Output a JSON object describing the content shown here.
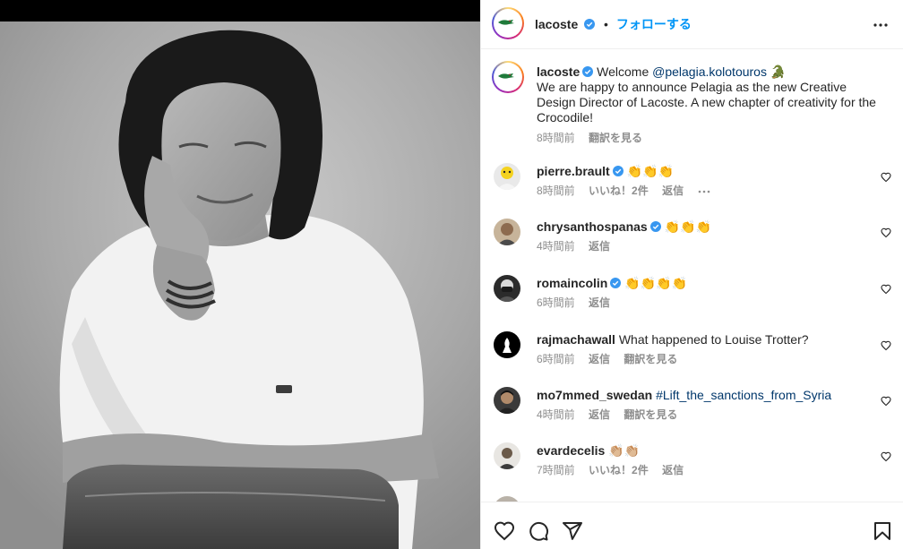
{
  "photo": {
    "alt": "Black and white portrait photo"
  },
  "header": {
    "username": "lacoste",
    "separator": "•",
    "follow_label": "フォローする"
  },
  "caption": {
    "username": "lacoste",
    "welcome": "Welcome ",
    "mention": "@pelagia.kolotouros",
    "emoji": "🐊",
    "text": "We are happy to announce Pelagia as the new Creative Design Director of Lacoste. A new chapter of creativity for the Crocodile!",
    "time": "8時間前",
    "see_translation": "翻訳を見る"
  },
  "comments": [
    {
      "username": "pierre.brault",
      "verified": true,
      "text": "👏👏👏",
      "time": "8時間前",
      "likes": "いいね！2件",
      "reply": "返信",
      "translate": ""
    },
    {
      "username": "chrysanthospanas",
      "verified": true,
      "text": "👏👏👏",
      "time": "4時間前",
      "likes": "",
      "reply": "返信",
      "translate": ""
    },
    {
      "username": "romaincolin",
      "verified": true,
      "text": "👏👏👏👏",
      "time": "6時間前",
      "likes": "",
      "reply": "返信",
      "translate": ""
    },
    {
      "username": "rajmachawall",
      "verified": false,
      "text": "What happened to Louise Trotter?",
      "time": "6時間前",
      "likes": "",
      "reply": "返信",
      "translate": "翻訳を見る"
    },
    {
      "username": "mo7mmed_swedan",
      "verified": false,
      "text": "#Lift_the_sanctions_from_Syria",
      "time": "4時間前",
      "likes": "",
      "reply": "返信",
      "translate": "翻訳を見る"
    },
    {
      "username": "evardecelis",
      "verified": false,
      "text": "👏🏼👏🏼",
      "time": "7時間前",
      "likes": "いいね！2件",
      "reply": "返信",
      "translate": ""
    }
  ],
  "colors": {
    "link": "#0095f6",
    "mention": "#00376b",
    "meta": "#8e8e8e",
    "verified": "#3897f0"
  },
  "icons": [
    "more-icon",
    "heart-icon",
    "comment-icon",
    "share-icon",
    "bookmark-icon",
    "verified-badge-icon"
  ]
}
